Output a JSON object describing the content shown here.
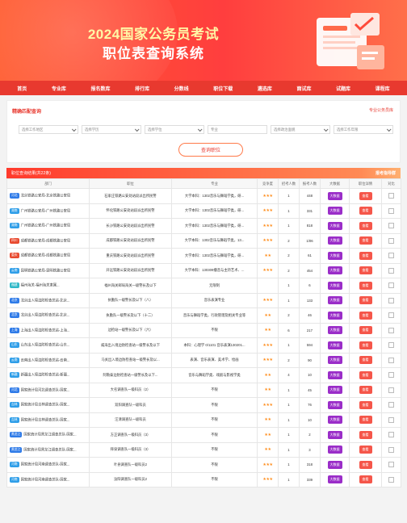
{
  "hero": {
    "title_line1": "2024国家公务员考试",
    "title_line2": "职位表查询系统"
  },
  "nav": [
    "首页",
    "专业库",
    "报名数库",
    "排行库",
    "分数线",
    "职位下载",
    "遴选库",
    "面试库",
    "试题库",
    "课程库"
  ],
  "search_panel": {
    "title": "精确匹配查询",
    "link": "专业公务员库",
    "filters": [
      {
        "name": "work-region",
        "label": "选择工作地区"
      },
      {
        "name": "education",
        "label": "选择学历"
      },
      {
        "name": "degree",
        "label": "选择学位"
      },
      {
        "name": "major",
        "label": "专业"
      },
      {
        "name": "political-status",
        "label": "选择政治面貌"
      },
      {
        "name": "work-years",
        "label": "选择工作年限"
      }
    ],
    "query_button": "查询职位"
  },
  "results": {
    "summary": "职位查询结果(共22条)",
    "right_link": "报考指导群",
    "columns": [
      "部门",
      "职位",
      "专业",
      "竞争度",
      "招考人数",
      "报考人数",
      "大数据",
      "职位详情",
      "对比"
    ],
    "big_data_label": "大数据",
    "detail_label": "查看",
    "rows": [
      {
        "tag": "河北",
        "tag_color": "#2f7be8",
        "dept": "北京铁路公安局-北京铁路公安局",
        "pos": "石家庄铁路公安处站段派出所民警",
        "major": "大学本科：1302音乐与舞蹈学类，研...",
        "stars": "★★★",
        "hire": "1",
        "apply": "448"
      },
      {
        "tag": "湖南",
        "tag_color": "#2f9ee8",
        "dept": "广州铁路公安局-广州铁路公安局",
        "pos": "怀化铁路公安处站段派出所民警",
        "major": "大学本科：1302音乐与舞蹈学类，研...",
        "stars": "★★★",
        "hire": "1",
        "apply": "331"
      },
      {
        "tag": "湖南",
        "tag_color": "#2f9ee8",
        "dept": "广州铁路公安局-广州铁路公安局",
        "pos": "长沙铁路公安处站段派出所民警",
        "major": "大学本科：1302音乐与舞蹈学类，研...",
        "stars": "★★★",
        "hire": "1",
        "apply": "818"
      },
      {
        "tag": "四川",
        "tag_color": "#e84a2f",
        "dept": "成都铁路公安局-成都铁路公安局",
        "pos": "成都铁路公安处站段派出所民警",
        "major": "大学本科：1302音乐与舞蹈学类，13...",
        "stars": "★★★",
        "hire": "2",
        "apply": "1/06"
      },
      {
        "tag": "重庆",
        "tag_color": "#e84a2f",
        "dept": "成都铁路公安局-成都铁路公安局",
        "pos": "重庆铁路公安处站段派出所民警",
        "major": "大学本科：1302音乐与舞蹈学类，研...",
        "stars": "★★",
        "hire": "2",
        "apply": "61"
      },
      {
        "tag": "云南",
        "tag_color": "#2f9ee8",
        "dept": "昆明铁路公安局-昆明铁路公安局",
        "pos": "开远铁路公安处站段派出所民警",
        "major": "大学本科：130309播音与主持艺术、...",
        "stars": "★★★",
        "hire": "2",
        "apply": "454"
      },
      {
        "tag": "福建",
        "tag_color": "#2fb8c8",
        "dept": "福州海关-福州海关隶属...",
        "pos": "福州海关邮局海关一级警长及以下",
        "major": "无限制",
        "stars": "",
        "hire": "1",
        "apply": "6"
      },
      {
        "tag": "北京",
        "tag_color": "#2f7be8",
        "dept": "北京出入境边防检查总站-北京...",
        "pos": "执勤队一级警长及以下（八）",
        "major": "音乐表演专业",
        "stars": "★★★",
        "hire": "1",
        "apply": "133"
      },
      {
        "tag": "北京",
        "tag_color": "#2f7be8",
        "dept": "北京出入境边防检查总站-北京...",
        "pos": "执勤队一级警长及以下（十二）",
        "major": "音乐与舞蹈学类，行政管理及相关专业等",
        "stars": "★★",
        "hire": "2",
        "apply": "46"
      },
      {
        "tag": "上海",
        "tag_color": "#2f7be8",
        "dept": "上海出入境边防检查总站-上海...",
        "pos": "边检站一级警长及以下（六）",
        "major": "不限",
        "stars": "★★",
        "hire": "6",
        "apply": "217"
      },
      {
        "tag": "山东",
        "tag_color": "#2f9ee8",
        "dept": "山东出入境边防检查总站-山东...",
        "pos": "威海出入境边防检查站一级警长及以下",
        "major": "本科：心理学 0/1101 音乐表演130201...",
        "stars": "★★★",
        "hire": "1",
        "apply": "594"
      },
      {
        "tag": "云南",
        "tag_color": "#2f9ee8",
        "dept": "云南出入境边防检查总站-云南...",
        "pos": "马关出入境边防检查站一级警长及以...",
        "major": "表演、音乐表演、美术学、绘画",
        "stars": "★★★",
        "hire": "2",
        "apply": "90"
      },
      {
        "tag": "新疆",
        "tag_color": "#2f9ee8",
        "dept": "新疆出入境边防检查总站-新疆...",
        "pos": "阿勒泰边防检查站一级警长及以下...",
        "major": "音乐与舞蹈学类、戏剧与影视学类",
        "stars": "★★",
        "hire": "4",
        "apply": "10"
      },
      {
        "tag": "河北",
        "tag_color": "#2f7be8",
        "dept": "国家统计局河北调查总队-国家...",
        "pos": "大名调查队一级科员（2）",
        "major": "不限",
        "stars": "★★",
        "hire": "1",
        "apply": "45"
      },
      {
        "tag": "吉林",
        "tag_color": "#2f9ee8",
        "dept": "国家统计局吉林调查总队-国家...",
        "pos": "双阳调查队一级科员",
        "major": "不限",
        "stars": "★★★",
        "hire": "1",
        "apply": "76"
      },
      {
        "tag": "吉林",
        "tag_color": "#2f9ee8",
        "dept": "国家统计局吉林调查总队-国家...",
        "pos": "汪清调查队一级科员",
        "major": "不限",
        "stars": "★★",
        "hire": "1",
        "apply": "10"
      },
      {
        "tag": "黑龙江",
        "tag_color": "#2f7be8",
        "dept": "国家统计局黑龙江调查总队-国家...",
        "pos": "方正调查队一级科员（3）",
        "major": "不限",
        "stars": "★★",
        "hire": "1",
        "apply": "2"
      },
      {
        "tag": "黑龙江",
        "tag_color": "#2f7be8",
        "dept": "国家统计局黑龙江调查总队-国家...",
        "pos": "拜泉调查队一级科员（3）",
        "major": "不限",
        "stars": "★★",
        "hire": "1",
        "apply": "3"
      },
      {
        "tag": "河南",
        "tag_color": "#2f9ee8",
        "dept": "国家统计局河南调查总队-国家...",
        "pos": "叶县调查队一级科员2",
        "major": "不限",
        "stars": "★★★",
        "hire": "1",
        "apply": "318"
      },
      {
        "tag": "河南",
        "tag_color": "#2f9ee8",
        "dept": "国家统计局河南调查总队-国家...",
        "pos": "汝阳调查队一级科员2",
        "major": "不限",
        "stars": "★★★",
        "hire": "1",
        "apply": "339"
      }
    ]
  }
}
